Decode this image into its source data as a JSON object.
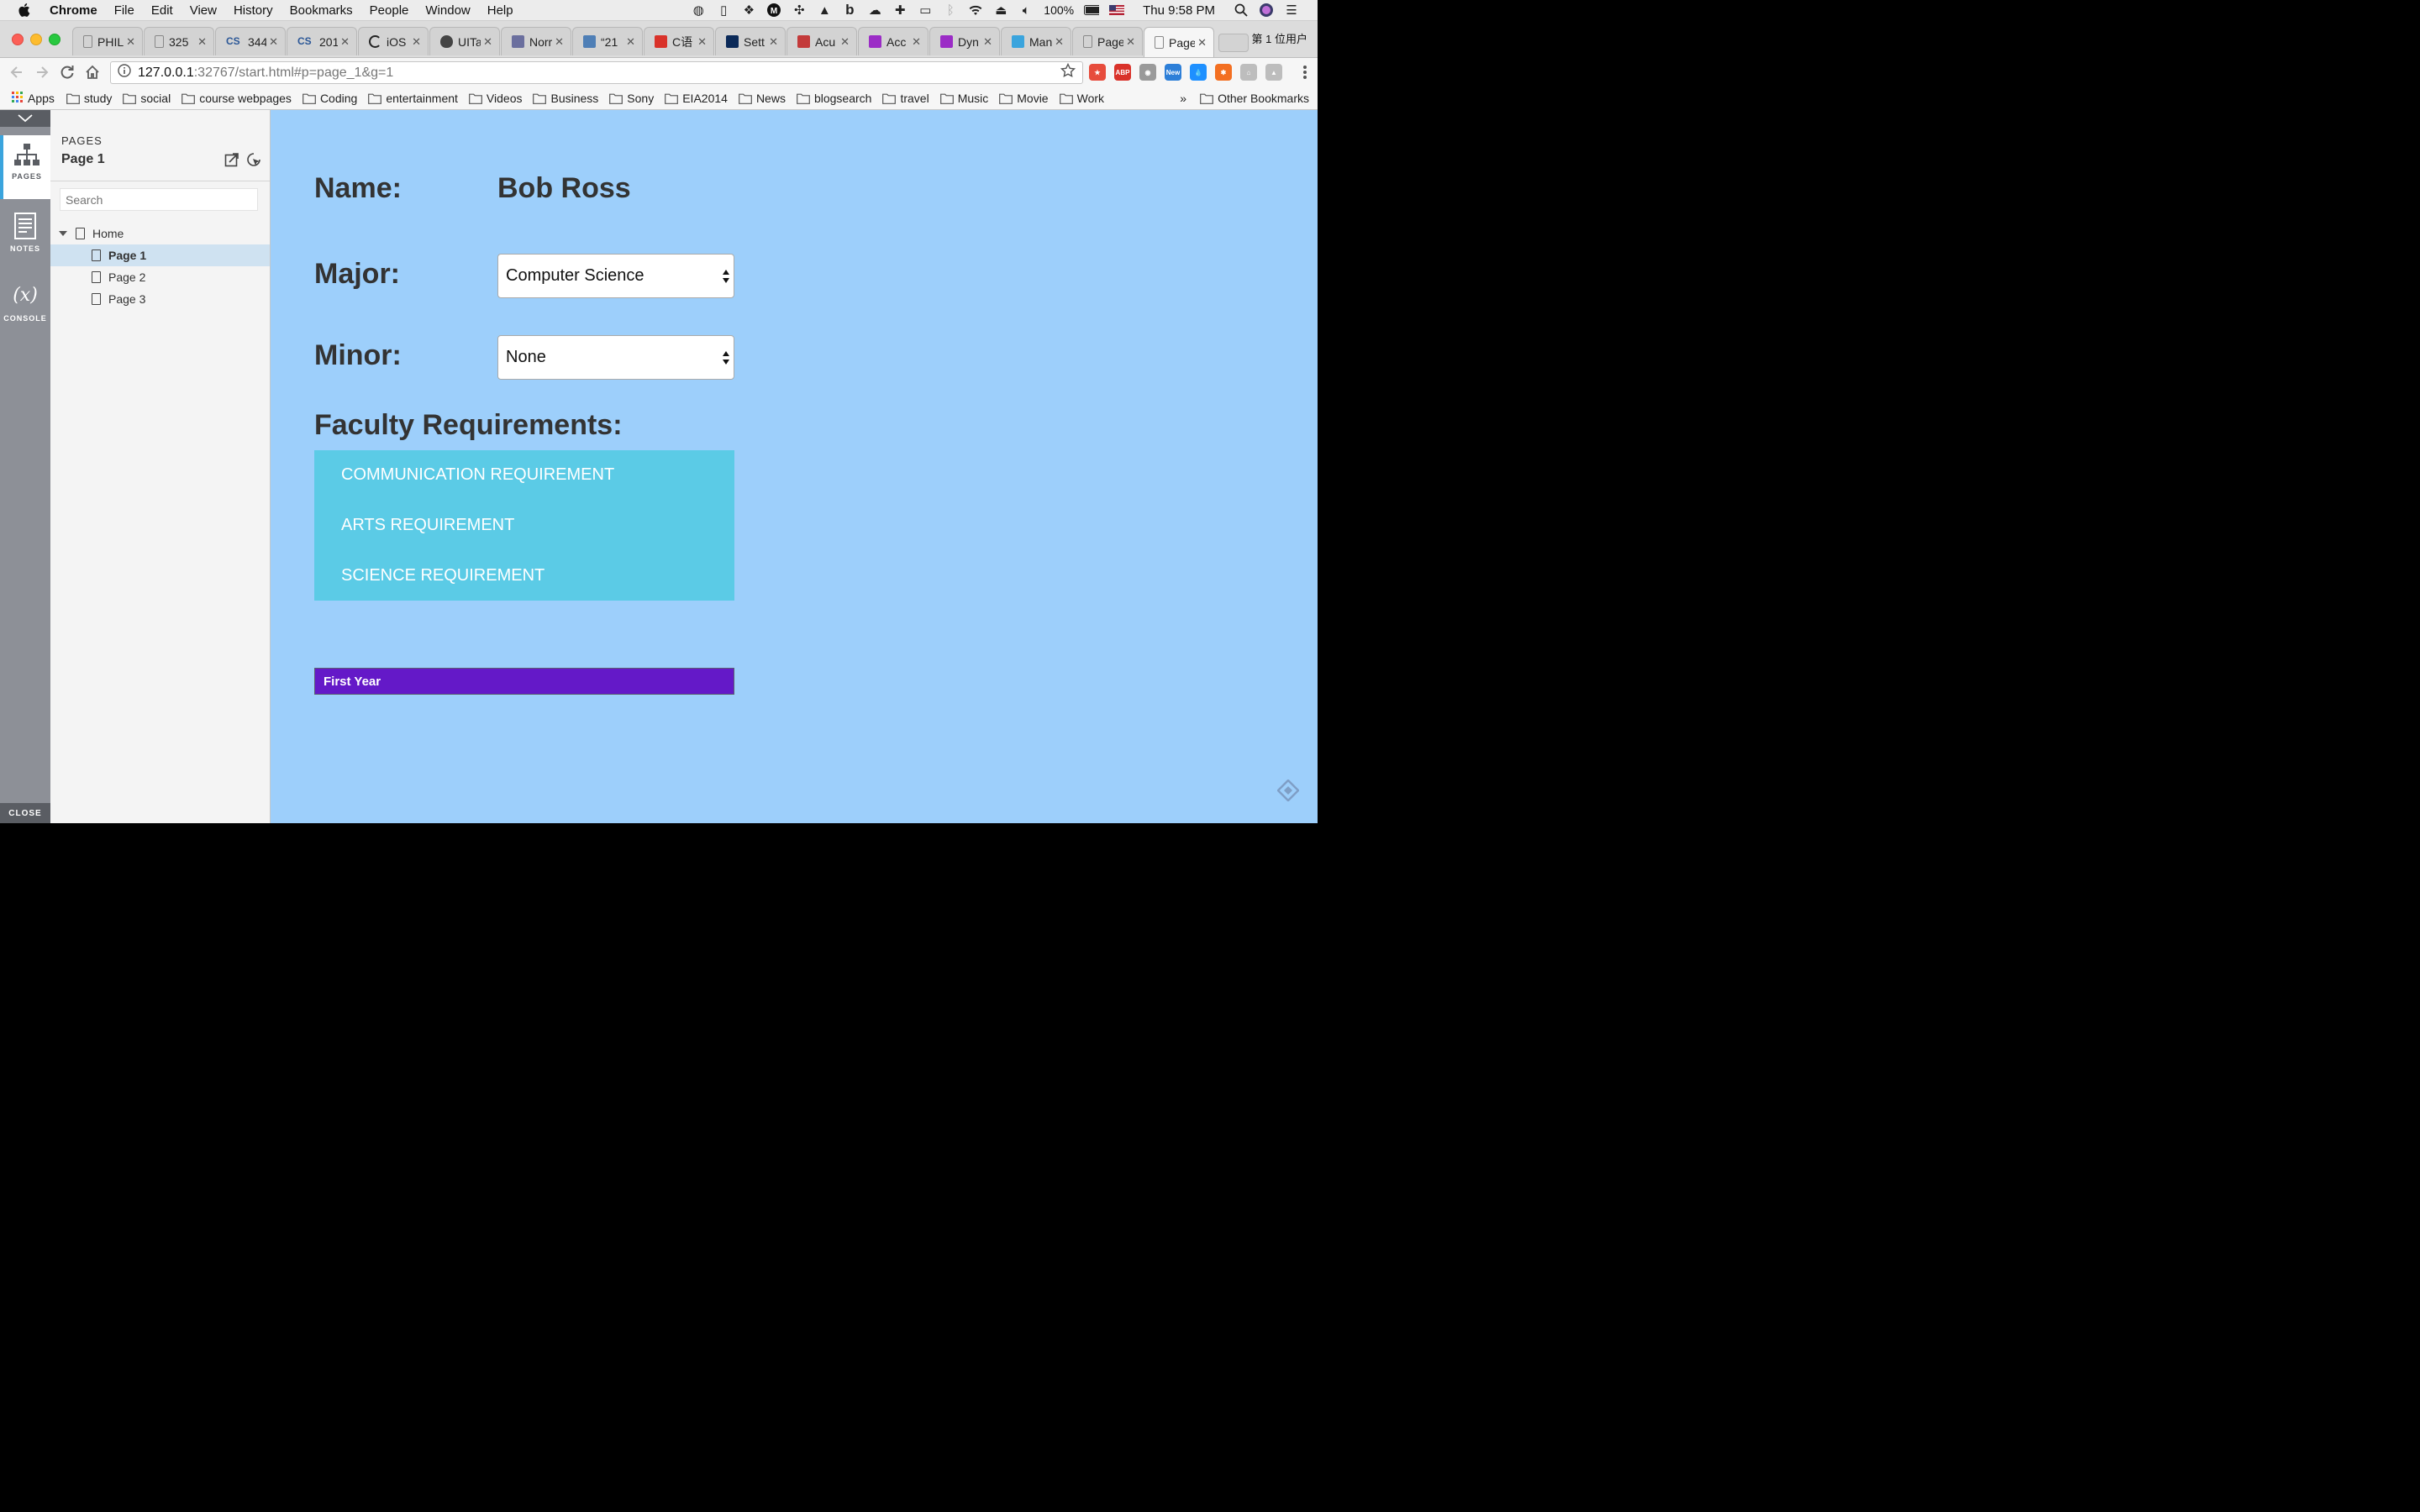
{
  "menubar": {
    "app": "Chrome",
    "items": [
      "File",
      "Edit",
      "View",
      "History",
      "Bookmarks",
      "People",
      "Window",
      "Help"
    ],
    "battery": "100%",
    "clock": "Thu 9:58 PM"
  },
  "tabs": [
    {
      "title": "PHIL",
      "favicon": "doc",
      "color": "#888888"
    },
    {
      "title": "325",
      "favicon": "doc",
      "color": "#888888"
    },
    {
      "title": "344",
      "favicon": "cs",
      "color": "#2b5797"
    },
    {
      "title": "201",
      "favicon": "cs",
      "color": "#2b5797"
    },
    {
      "title": "iOS",
      "favicon": "spinner",
      "color": "#222222"
    },
    {
      "title": "UITa",
      "favicon": "apple",
      "color": "#444444"
    },
    {
      "title": "Norr",
      "favicon": "image",
      "color": "#6b6f9e"
    },
    {
      "title": "“21",
      "favicon": "image",
      "color": "#4f7fb6"
    },
    {
      "title": "C语",
      "favicon": "c",
      "color": "#d9322a"
    },
    {
      "title": "Sett",
      "favicon": "ubc",
      "color": "#0b2a59"
    },
    {
      "title": "Acu",
      "favicon": "flag",
      "color": "#c33a3a"
    },
    {
      "title": "Acc",
      "favicon": "onenote",
      "color": "#9b2cc6"
    },
    {
      "title": "Dyn",
      "favicon": "onenote",
      "color": "#9b2cc6"
    },
    {
      "title": "Man",
      "favicon": "cloud",
      "color": "#3aa4dd"
    },
    {
      "title": "Page",
      "favicon": "doc",
      "color": "#888888"
    },
    {
      "title": "Page",
      "favicon": "doc",
      "color": "#888888",
      "active": true
    }
  ],
  "profile": "第 1 位用户",
  "address": {
    "host": "127.0.0.1",
    "path": ":32767/start.html#p=page_1&g=1"
  },
  "extensions": [
    {
      "name": "bookmark-ext",
      "color": "#e74c3c",
      "label": "★"
    },
    {
      "name": "adblock-ext",
      "color": "#d9322a",
      "label": "ABP"
    },
    {
      "name": "camera-ext",
      "color": "#9a9a9a",
      "label": "◉"
    },
    {
      "name": "new-ext",
      "color": "#2d7fd8",
      "label": "New"
    },
    {
      "name": "drop-ext",
      "color": "#1e90ff",
      "label": "💧"
    },
    {
      "name": "sun-ext",
      "color": "#f36f21",
      "label": "✱"
    },
    {
      "name": "home-ext",
      "color": "#bdbdbd",
      "label": "⌂"
    },
    {
      "name": "drive-ext",
      "color": "#bdbdbd",
      "label": "▲"
    }
  ],
  "bookmarks": {
    "apps": "Apps",
    "folders": [
      "study",
      "social",
      "course webpages",
      "Coding",
      "entertainment",
      "Videos",
      "Business",
      "Sony",
      "EIA2014",
      "News",
      "blogsearch",
      "travel",
      "Music",
      "Movie",
      "Work"
    ],
    "more": "»",
    "other": "Other Bookmarks"
  },
  "rail": {
    "pages": "PAGES",
    "notes": "NOTES",
    "console": "CONSOLE",
    "close": "CLOSE"
  },
  "panel": {
    "label": "PAGES",
    "current": "Page 1",
    "search_placeholder": "Search",
    "home": "Home",
    "pages": [
      "Page 1",
      "Page 2",
      "Page 3"
    ]
  },
  "form": {
    "name_label": "Name:",
    "name_value": "Bob Ross",
    "major_label": "Major:",
    "major_value": "Computer Science",
    "minor_label": "Minor:",
    "minor_value": "None",
    "faculty_title": "Faculty Requirements:",
    "requirements": [
      "COMMUNICATION REQUIREMENT",
      "ARTS REQUIREMENT",
      "SCIENCE REQUIREMENT"
    ],
    "year_label": "First Year"
  },
  "colors": {
    "canvas": "#9dcffb",
    "requirements_box": "#5bcbe6",
    "year_bar": "#6419c8",
    "rail": "#8d9097",
    "panel_selection": "#cfe2f1"
  }
}
